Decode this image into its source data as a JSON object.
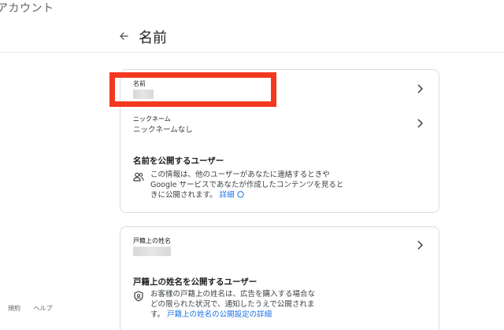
{
  "app": {
    "title": "アカウント"
  },
  "header": {
    "page_title": "名前"
  },
  "card1": {
    "name": {
      "label": "名前"
    },
    "nickname": {
      "label": "ニックネーム",
      "value": "ニックネームなし"
    },
    "public_section": {
      "heading": "名前を公開するユーザー",
      "lines": [
        "この情報は、他のユーザーがあなたに連絡するときや",
        "Google サービスであなたが作成したコンテンツを見ると",
        "きに公開されます。"
      ],
      "link": "詳細"
    }
  },
  "card2": {
    "legal_name": {
      "label": "戸籍上の姓名"
    },
    "public_section": {
      "heading": "戸籍上の姓名を公開するユーザー",
      "lines": [
        "お客様の戸籍上の姓名は、広告を購入する場合な",
        "どの限られた状況で、通知したうえで公開されま",
        "す。"
      ],
      "link": "戸籍上の姓名の公開設定の詳細"
    }
  },
  "footer": {
    "terms": "規約",
    "help": "ヘルプ"
  },
  "colors": {
    "highlight": "#f2391f",
    "link": "#1a73e8"
  }
}
